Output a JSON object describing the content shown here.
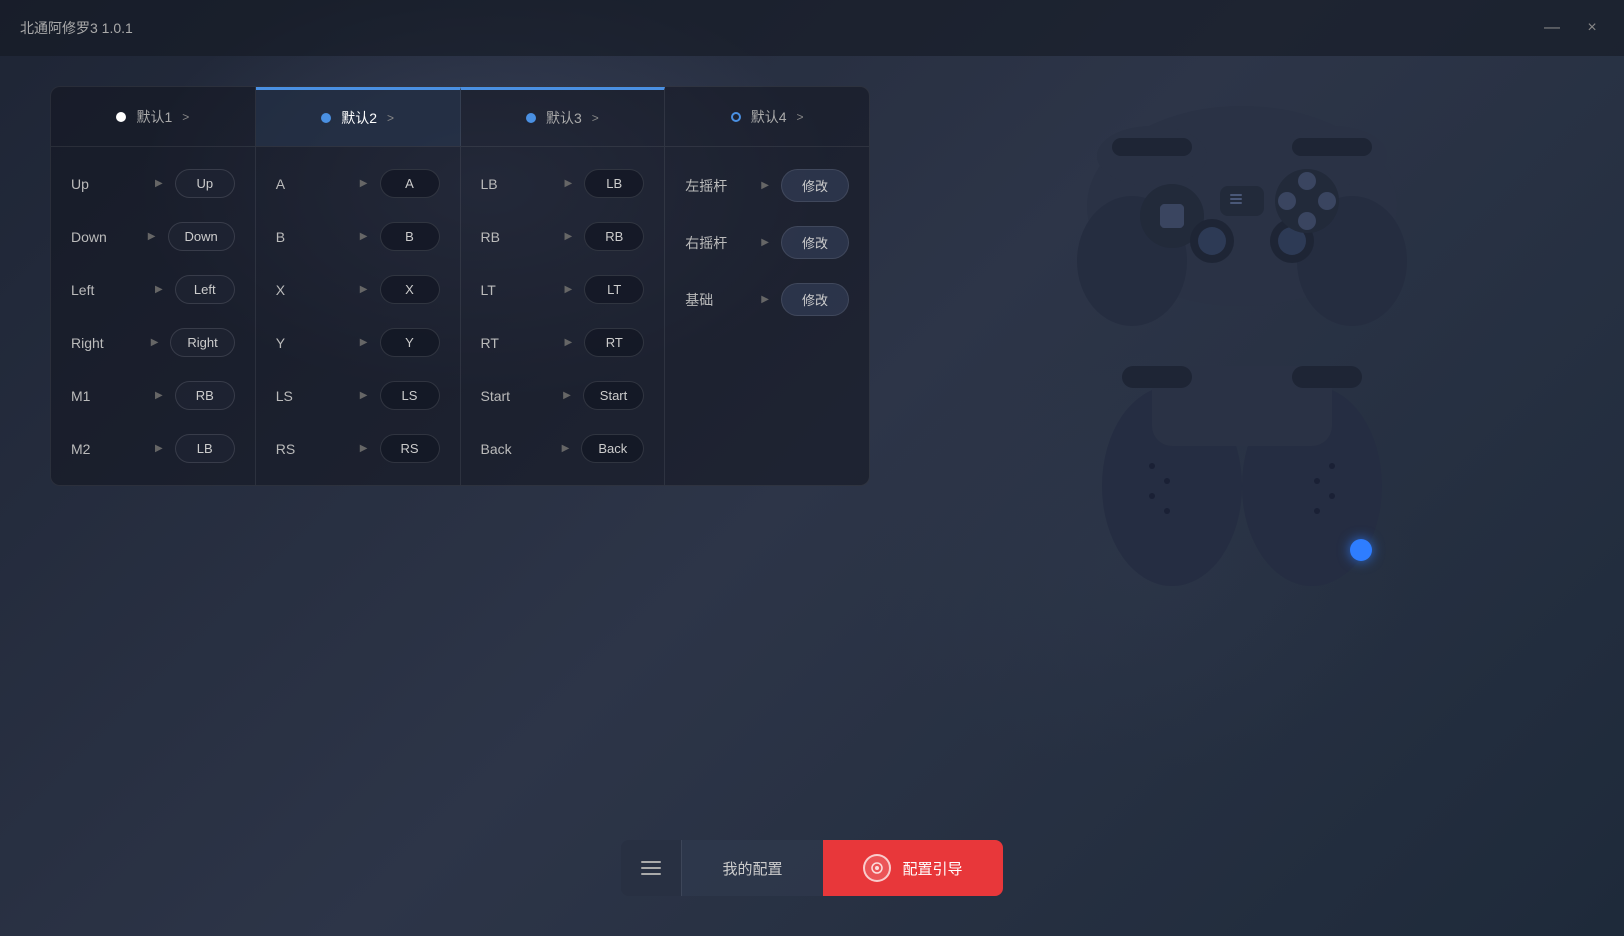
{
  "app": {
    "title": "北通阿修罗3  1.0.1"
  },
  "titlebar": {
    "minimize_label": "—",
    "close_label": "×"
  },
  "tabs": [
    {
      "id": "tab1",
      "label": "默认1",
      "arrow": ">",
      "dot": "white",
      "active": false
    },
    {
      "id": "tab2",
      "label": "默认2",
      "arrow": ">",
      "dot": "blue",
      "active": true
    },
    {
      "id": "tab3",
      "label": "默认3",
      "arrow": ">",
      "dot": "blue",
      "active": false
    },
    {
      "id": "tab4",
      "label": "默认4",
      "arrow": ">",
      "dot": "blue-outline",
      "active": false
    }
  ],
  "panel1": {
    "rows": [
      {
        "label": "Up",
        "value": "Up"
      },
      {
        "label": "Down",
        "value": "Down"
      },
      {
        "label": "Left",
        "value": "Left"
      },
      {
        "label": "Right",
        "value": "Right"
      },
      {
        "label": "M1",
        "value": "RB"
      },
      {
        "label": "M2",
        "value": "LB"
      }
    ]
  },
  "panel2": {
    "rows": [
      {
        "label": "A",
        "value": "A"
      },
      {
        "label": "B",
        "value": "B"
      },
      {
        "label": "X",
        "value": "X"
      },
      {
        "label": "Y",
        "value": "Y"
      },
      {
        "label": "LS",
        "value": "LS"
      },
      {
        "label": "RS",
        "value": "RS"
      }
    ]
  },
  "panel3": {
    "rows": [
      {
        "label": "LB",
        "value": "LB"
      },
      {
        "label": "RB",
        "value": "RB"
      },
      {
        "label": "LT",
        "value": "LT"
      },
      {
        "label": "RT",
        "value": "RT"
      },
      {
        "label": "Start",
        "value": "Start"
      },
      {
        "label": "Back",
        "value": "Back"
      }
    ]
  },
  "panel4": {
    "rows": [
      {
        "label": "左摇杆",
        "value": "修改"
      },
      {
        "label": "右摇杆",
        "value": "修改"
      },
      {
        "label": "基础",
        "value": "修改"
      }
    ]
  },
  "bottom": {
    "my_config_label": "我的配置",
    "config_guide_label": "配置引导"
  }
}
